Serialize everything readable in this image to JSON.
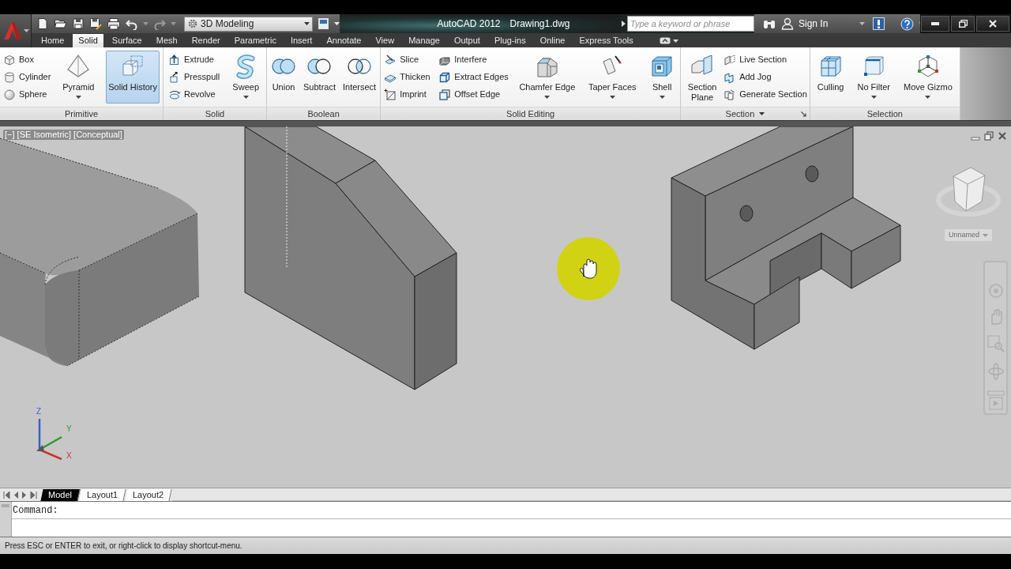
{
  "quick_access": {
    "workspace": "3D Modeling"
  },
  "title_bar": {
    "app_name": "AutoCAD 2012",
    "document": "Drawing1.dwg"
  },
  "search": {
    "placeholder": "Type a keyword or phrase"
  },
  "account": {
    "label": "Sign In"
  },
  "ribbon_tabs": [
    {
      "label": "Home",
      "selected": false
    },
    {
      "label": "Solid",
      "selected": true
    },
    {
      "label": "Surface",
      "selected": false
    },
    {
      "label": "Mesh",
      "selected": false
    },
    {
      "label": "Render",
      "selected": false
    },
    {
      "label": "Parametric",
      "selected": false
    },
    {
      "label": "Insert",
      "selected": false
    },
    {
      "label": "Annotate",
      "selected": false
    },
    {
      "label": "View",
      "selected": false
    },
    {
      "label": "Manage",
      "selected": false
    },
    {
      "label": "Output",
      "selected": false
    },
    {
      "label": "Plug-ins",
      "selected": false
    },
    {
      "label": "Online",
      "selected": false
    },
    {
      "label": "Express Tools",
      "selected": false
    }
  ],
  "ribbon_panels": [
    {
      "title": "Primitive",
      "items": [
        {
          "kind": "stack",
          "tools": [
            {
              "label": "Box"
            },
            {
              "label": "Cylinder"
            },
            {
              "label": "Sphere"
            }
          ]
        },
        {
          "kind": "large",
          "label": "Pyramid",
          "dropdown": true,
          "on": false
        },
        {
          "kind": "large",
          "label": "Solid History",
          "dropdown": false,
          "on": true
        }
      ]
    },
    {
      "title": "Solid",
      "items": [
        {
          "kind": "stack",
          "tools": [
            {
              "label": "Extrude"
            },
            {
              "label": "Presspull"
            },
            {
              "label": "Revolve"
            }
          ]
        },
        {
          "kind": "large",
          "label": "Sweep",
          "dropdown": true,
          "on": false
        }
      ]
    },
    {
      "title": "Boolean",
      "items": [
        {
          "kind": "large",
          "label": "Union",
          "dropdown": false,
          "on": false
        },
        {
          "kind": "large",
          "label": "Subtract",
          "dropdown": false,
          "on": false
        },
        {
          "kind": "large",
          "label": "Intersect",
          "dropdown": false,
          "on": false
        }
      ]
    },
    {
      "title": "Solid Editing",
      "items": [
        {
          "kind": "stack",
          "tools": [
            {
              "label": "Slice"
            },
            {
              "label": "Thicken"
            },
            {
              "label": "Imprint"
            }
          ]
        },
        {
          "kind": "stack",
          "tools": [
            {
              "label": "Interfere"
            },
            {
              "label": "Extract Edges"
            },
            {
              "label": "Offset Edge"
            }
          ]
        },
        {
          "kind": "large",
          "label": "Chamfer Edge",
          "dropdown": true,
          "on": false
        },
        {
          "kind": "large",
          "label": "Taper Faces",
          "dropdown": true,
          "on": false
        },
        {
          "kind": "large",
          "label": "Shell",
          "dropdown": true,
          "on": false
        }
      ]
    },
    {
      "title": "Section",
      "menu": true,
      "launcher": true,
      "items": [
        {
          "kind": "large",
          "label": "Section Plane",
          "dropdown": false,
          "on": false
        },
        {
          "kind": "stack",
          "tools": [
            {
              "label": "Live Section"
            },
            {
              "label": "Add Jog"
            },
            {
              "label": "Generate Section"
            }
          ]
        }
      ]
    },
    {
      "title": "Selection",
      "items": [
        {
          "kind": "large",
          "label": "Culling",
          "dropdown": false,
          "on": false
        },
        {
          "kind": "large",
          "label": "No Filter",
          "dropdown": true,
          "on": false
        },
        {
          "kind": "large",
          "label": "Move Gizmo",
          "dropdown": true,
          "on": false
        }
      ]
    }
  ],
  "viewport": {
    "label": "[−] [SE Isometric] [Conceptual]",
    "named_view": "Unnamed",
    "ucs_axes": [
      "Z",
      "Y",
      "X"
    ]
  },
  "layout_tabs": [
    {
      "label": "Model",
      "selected": true
    },
    {
      "label": "Layout1",
      "selected": false
    },
    {
      "label": "Layout2",
      "selected": false
    }
  ],
  "command_line": {
    "prompt": "Command:"
  },
  "status_bar": {
    "message": "Press ESC or ENTER to exit, or right-click to display shortcut-menu."
  }
}
